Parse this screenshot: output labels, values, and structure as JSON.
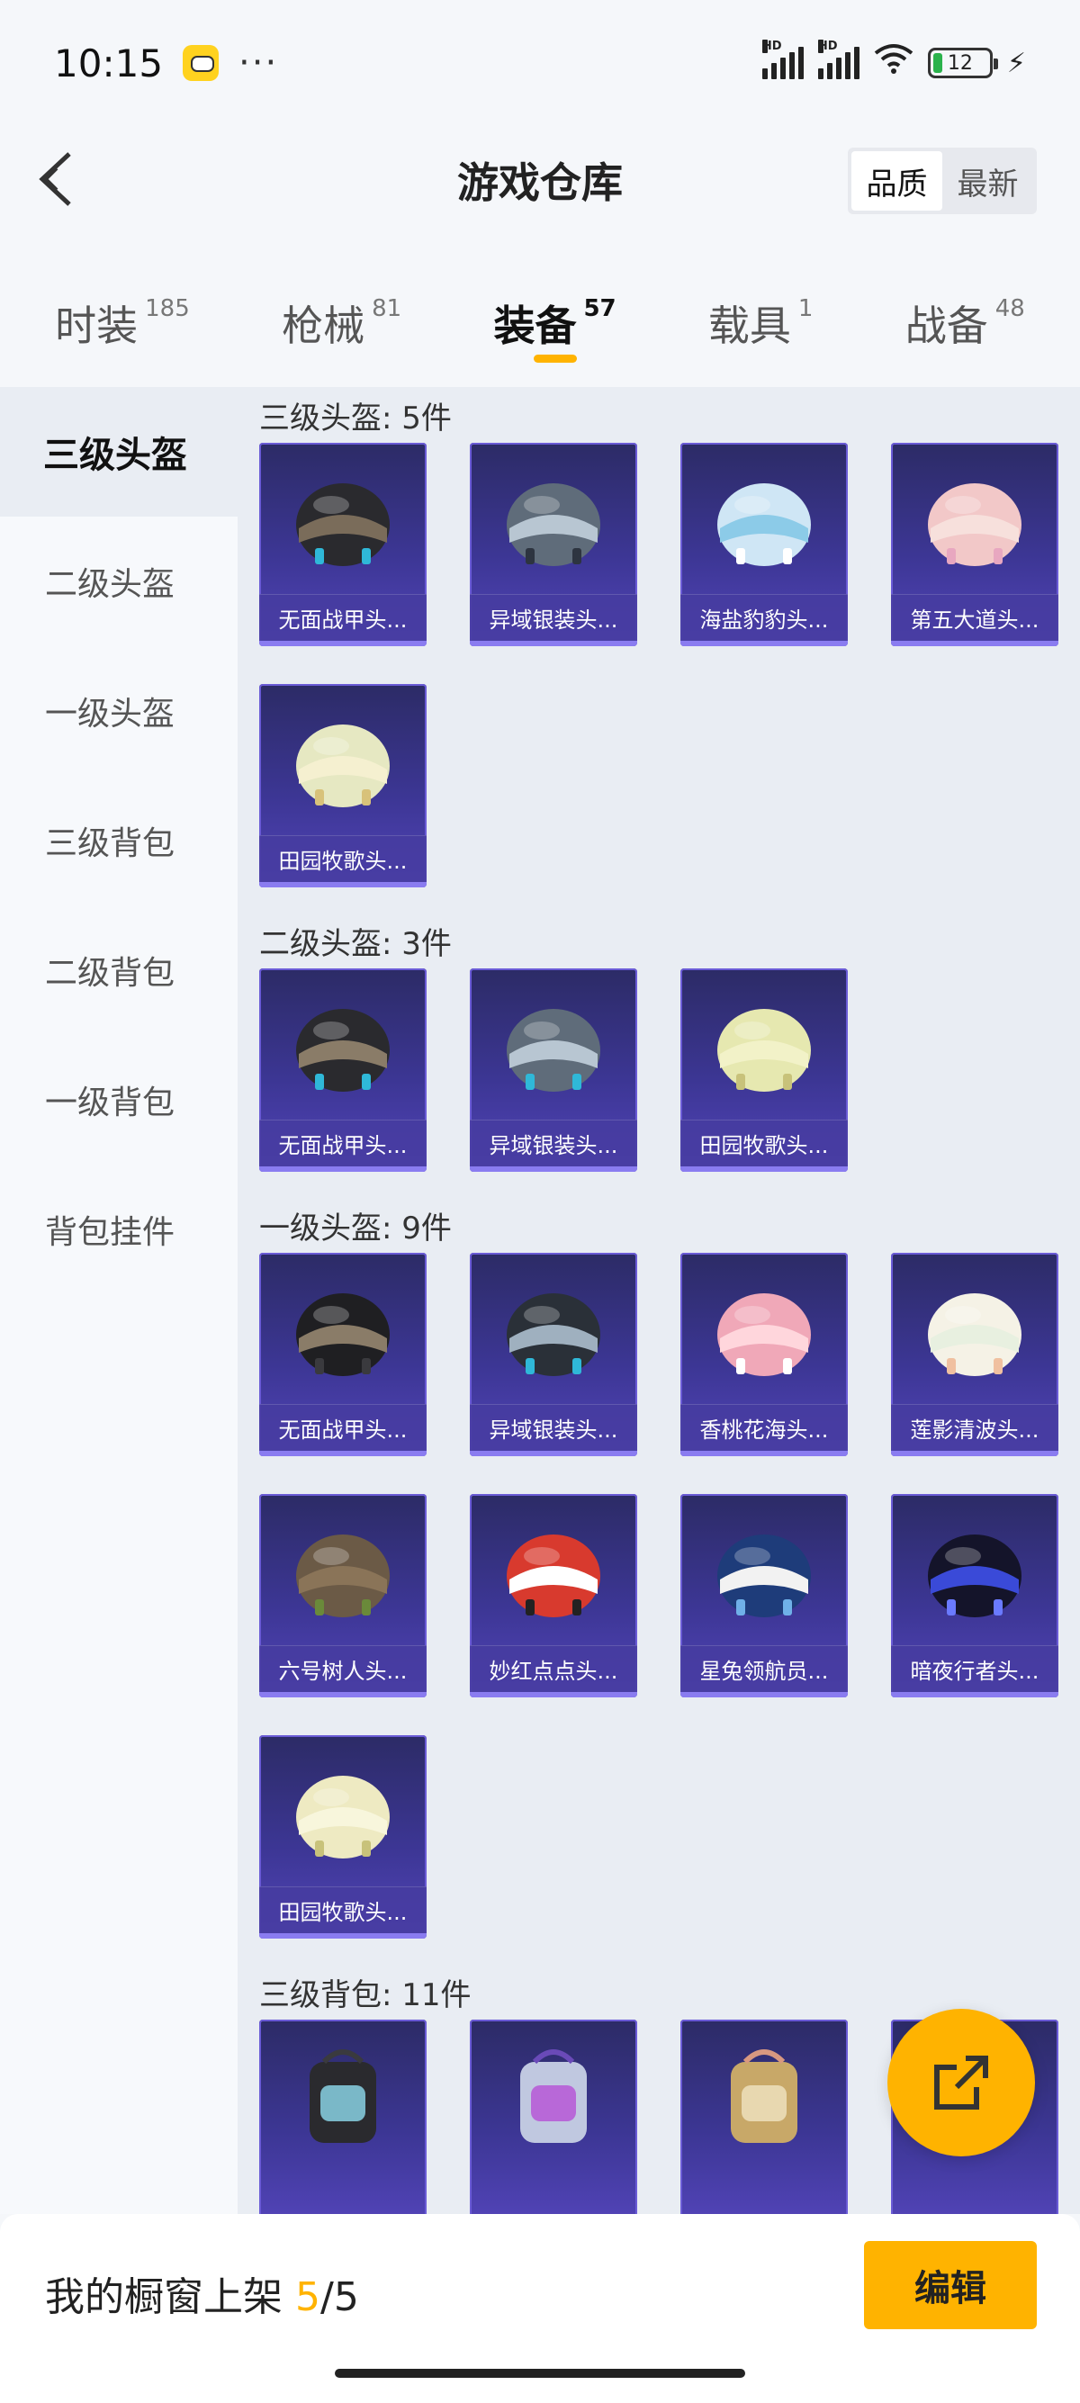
{
  "status_bar": {
    "time": "10:15",
    "dots": "···",
    "battery": "12"
  },
  "header": {
    "title": "游戏仓库",
    "sort": {
      "quality_label": "品质",
      "newest_label": "最新",
      "active": "quality"
    }
  },
  "tabs": [
    {
      "label": "时装",
      "count": "185"
    },
    {
      "label": "枪械",
      "count": "81"
    },
    {
      "label": "装备",
      "count": "57",
      "active": true
    },
    {
      "label": "载具",
      "count": "1"
    },
    {
      "label": "战备",
      "count": "48"
    }
  ],
  "sidebar": {
    "items": [
      "三级头盔",
      "二级头盔",
      "一级头盔",
      "三级背包",
      "二级背包",
      "一级背包",
      "背包挂件"
    ],
    "active_index": 0
  },
  "sections": [
    {
      "title": "三级头盔: 5件",
      "items": [
        {
          "name": "无面战甲头...",
          "colors": [
            "#2a2a2e",
            "#7a6c5a",
            "#2fb8d8"
          ]
        },
        {
          "name": "异域银装头...",
          "colors": [
            "#5f6c7a",
            "#b8c6d2",
            "#2d3440"
          ]
        },
        {
          "name": "海盐豹豹头...",
          "colors": [
            "#cfe6f5",
            "#8ccbe8",
            "#ffffff"
          ]
        },
        {
          "name": "第五大道头...",
          "colors": [
            "#f2c8c8",
            "#f7e0dc",
            "#e8a7c0"
          ]
        },
        {
          "name": "田园牧歌头...",
          "colors": [
            "#e6e8c2",
            "#f5f0d0",
            "#d8c27a"
          ]
        }
      ]
    },
    {
      "title": "二级头盔: 3件",
      "items": [
        {
          "name": "无面战甲头...",
          "colors": [
            "#2a2a2e",
            "#8a7c68",
            "#2fb8d8"
          ]
        },
        {
          "name": "异域银装头...",
          "colors": [
            "#5f6c7a",
            "#b8c6d2",
            "#2fb8d8"
          ]
        },
        {
          "name": "田园牧歌头...",
          "colors": [
            "#e6e8b0",
            "#f2f2c8",
            "#c8c27a"
          ]
        }
      ]
    },
    {
      "title": "一级头盔: 9件",
      "items": [
        {
          "name": "无面战甲头...",
          "colors": [
            "#1f1f22",
            "#8a7c68",
            "#3a3a3e"
          ]
        },
        {
          "name": "异域银装头...",
          "colors": [
            "#2a3038",
            "#9fb0bf",
            "#2fb8d8"
          ]
        },
        {
          "name": "香桃花海头...",
          "colors": [
            "#f0a8b8",
            "#ffd6dc",
            "#ffffff"
          ]
        },
        {
          "name": "莲影清波头...",
          "colors": [
            "#f5f2e6",
            "#e8f0e0",
            "#f0c0a0"
          ]
        },
        {
          "name": "六号树人头...",
          "colors": [
            "#6b5a46",
            "#8a7458",
            "#6a8a3a"
          ]
        },
        {
          "name": "妙红点点头...",
          "colors": [
            "#d83a2e",
            "#ffffff",
            "#222222"
          ]
        },
        {
          "name": "星兔领航员...",
          "colors": [
            "#1e3c7a",
            "#f2f2f2",
            "#6fb0e8"
          ]
        },
        {
          "name": "暗夜行者头...",
          "colors": [
            "#14142a",
            "#3a4ad8",
            "#6a7aff"
          ]
        },
        {
          "name": "田园牧歌头...",
          "colors": [
            "#eeeac2",
            "#f8f6dc",
            "#c8c27a"
          ]
        }
      ]
    },
    {
      "title": "三级背包: 11件",
      "items": [
        {
          "name": "",
          "colors": [
            "#2a2a2e",
            "#7ab8c8",
            "#3a3a3e"
          ]
        },
        {
          "name": "",
          "colors": [
            "#c0c8e0",
            "#b868d8",
            "#6a4ab8"
          ]
        },
        {
          "name": "",
          "colors": [
            "#c8a868",
            "#e8d8b0",
            "#d89880"
          ]
        },
        {
          "name": "",
          "colors": [
            "#3a4250",
            "#5ab0c8",
            "#2a2a30"
          ]
        }
      ]
    }
  ],
  "bottom_bar": {
    "shelf_label": "我的橱窗上架",
    "shelf_current": "5",
    "shelf_sep": "/",
    "shelf_total": "5",
    "edit_label": "编辑"
  },
  "icons": {
    "back": "chevron-left-icon",
    "share": "external-link-icon",
    "signal": "signal-icon",
    "wifi": "wifi-icon",
    "battery": "battery-icon",
    "charging": "charging-icon"
  },
  "colors": {
    "accent": "#ffb300",
    "card_bg": "#3c3694"
  }
}
